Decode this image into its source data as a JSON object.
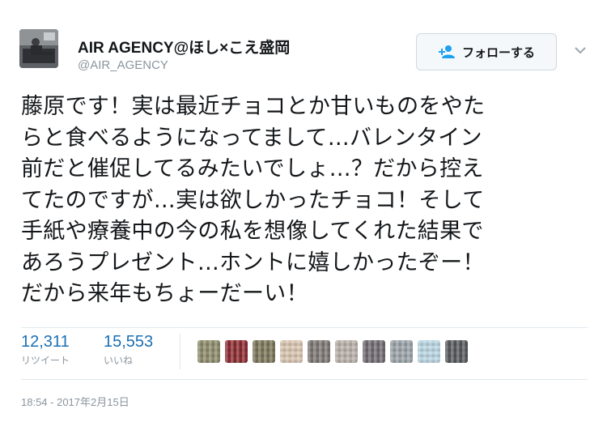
{
  "profile": {
    "display_name": "AIR AGENCY@ほし×こえ盛岡",
    "handle": "@AIR_AGENCY",
    "avatar_icon": "profile-photo"
  },
  "follow_button": {
    "label": "フォローする",
    "icon": "add-user-icon"
  },
  "menu_caret_icon": "chevron-down-icon",
  "tweet": {
    "lines": [
      "藤原です！実は最近チョコとか甘いものをやた",
      "らと食べるようになってまして…バレンタイン",
      "前だと催促してるみたいでしょ…？だから控え",
      "てたのですが…実は欲しかったチョコ！そして",
      "手紙や療養中の今の私を想像してくれた結果で",
      "あろうプレゼント…ホントに嬉しかったぞー！",
      "だから来年もちょーだーい！"
    ]
  },
  "stats": {
    "retweets": {
      "value": "12,311",
      "label": "リツイート"
    },
    "likes": {
      "value": "15,553",
      "label": "いいね"
    }
  },
  "likers": {
    "colors": [
      "#8c8a6a",
      "#8b2a2f",
      "#7a7558",
      "#d8c4b0",
      "#7c7672",
      "#b8b0a8",
      "#6f6a70",
      "#9aa3a8",
      "#b9d6e2",
      "#55585b"
    ]
  },
  "timestamp": "18:54 - 2017年2月15日"
}
